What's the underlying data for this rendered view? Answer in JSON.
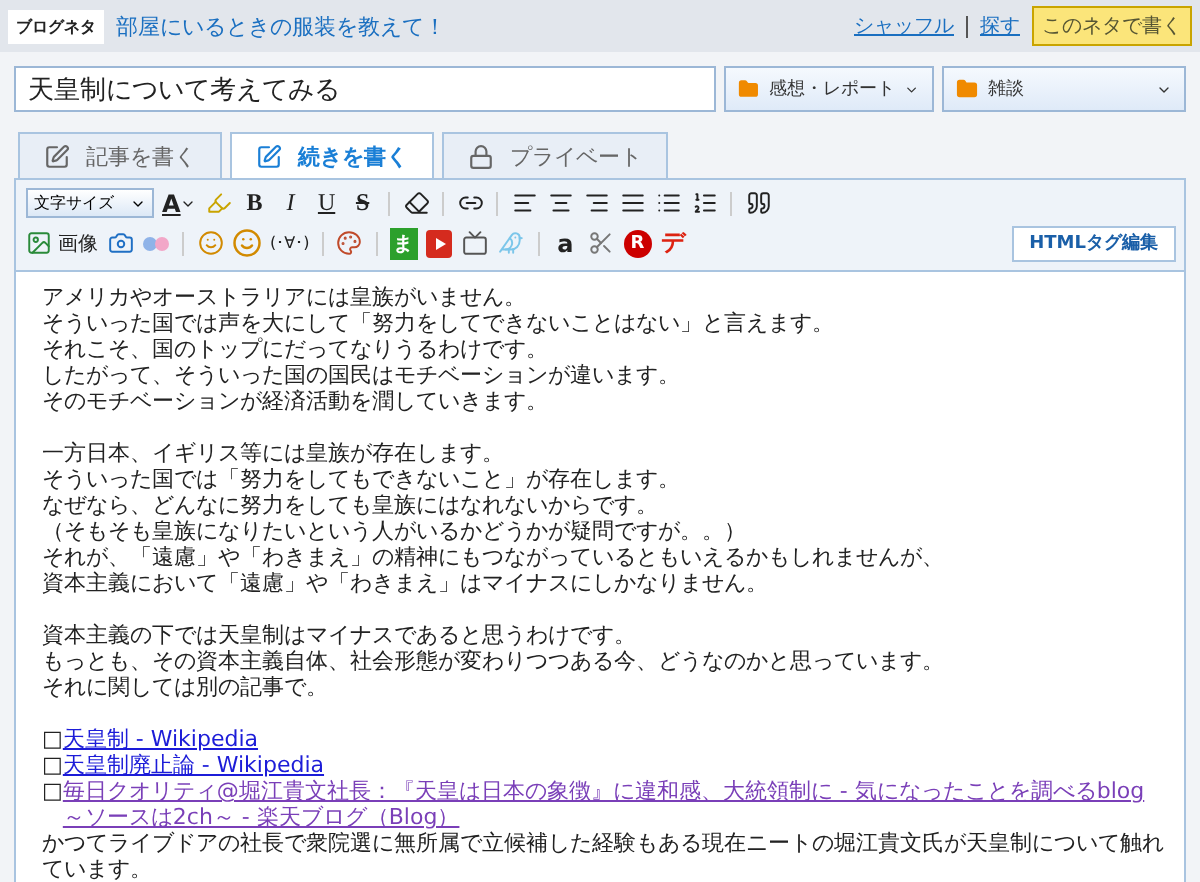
{
  "topbar": {
    "label": "ブログネタ",
    "topic": "部屋にいるときの服装を教えて！",
    "links": [
      "シャッフル",
      "探す"
    ],
    "button": "このネタで書く"
  },
  "title_field": {
    "value": "天皇制について考えてみる"
  },
  "categories": [
    {
      "label": "感想・レポート"
    },
    {
      "label": "雑談"
    }
  ],
  "tabs": [
    {
      "label": "記事を書く",
      "kind": "write",
      "selected": false
    },
    {
      "label": "続きを書く",
      "kind": "continue",
      "selected": true
    },
    {
      "label": "プライベート",
      "kind": "private",
      "selected": false
    }
  ],
  "toolbar": {
    "format_tools": [
      {
        "kind": "select",
        "text": "文字サイズ"
      },
      {
        "kind": "font-color",
        "text": "A"
      },
      {
        "kind": "highlight"
      },
      {
        "kind": "bold",
        "text": "B"
      },
      {
        "kind": "italic",
        "text": "I"
      },
      {
        "kind": "underline",
        "text": "U"
      },
      {
        "kind": "strike",
        "text": "S"
      },
      {
        "kind": "sep"
      },
      {
        "kind": "eraser"
      },
      {
        "kind": "sep"
      },
      {
        "kind": "link"
      },
      {
        "kind": "sep"
      },
      {
        "kind": "align-left"
      },
      {
        "kind": "align-center"
      },
      {
        "kind": "align-right"
      },
      {
        "kind": "align-justify"
      },
      {
        "kind": "list-bullet"
      },
      {
        "kind": "list-number"
      },
      {
        "kind": "sep"
      },
      {
        "kind": "quote"
      }
    ],
    "insert_tools": [
      {
        "kind": "image",
        "text": "画像"
      },
      {
        "kind": "photo"
      },
      {
        "kind": "dots"
      },
      {
        "kind": "sep"
      },
      {
        "kind": "smile"
      },
      {
        "kind": "smile-pen"
      },
      {
        "kind": "kaomoji",
        "text": "(･∀･)"
      },
      {
        "kind": "sep"
      },
      {
        "kind": "palette"
      },
      {
        "kind": "sep"
      },
      {
        "kind": "ma",
        "text": "ま"
      },
      {
        "kind": "video"
      },
      {
        "kind": "tv"
      },
      {
        "kind": "bird"
      },
      {
        "kind": "sep"
      },
      {
        "kind": "amazon",
        "text": "a"
      },
      {
        "kind": "scissors"
      },
      {
        "kind": "rakuten",
        "text": "R"
      },
      {
        "kind": "de",
        "text": "デ"
      }
    ],
    "html_button": "HTMLタグ編集"
  },
  "body": [
    {
      "kind": "paragraph",
      "lines": [
        "アメリカやオーストラリアには皇族がいません。",
        "そういった国では声を大にして「努力をしてできないことはない」と言えます。",
        "それこそ、国のトップにだってなりうるわけです。",
        "したがって、そういった国の国民はモチベーションが違います。",
        "そのモチベーションが経済活動を潤していきます。"
      ]
    },
    {
      "kind": "paragraph",
      "lines": [
        "一方日本、イギリス等には皇族が存在します。",
        "そういった国では「努力をしてもできないこと」が存在します。",
        "なぜなら、どんなに努力をしても皇族にはなれないからです。",
        "（そもそも皇族になりたいという人がいるかどうかが疑問ですが。。）",
        "それが、「遠慮」や「わきまえ」の精神にもつながっているともいえるかもしれませんが、",
        "資本主義において「遠慮」や「わきまえ」はマイナスにしかなりません。"
      ]
    },
    {
      "kind": "paragraph",
      "lines": [
        "資本主義の下では天皇制はマイナスであると思うわけです。",
        "もっとも、その資本主義自体、社会形態が変わりつつある今、どうなのかと思っています。",
        "それに関しては別の記事で。"
      ]
    },
    {
      "kind": "links",
      "items": [
        {
          "bullet": "□",
          "text": "天皇制 - Wikipedia",
          "visited": false
        },
        {
          "bullet": "□",
          "text": "天皇制廃止論 - Wikipedia",
          "visited": false
        },
        {
          "bullet": "□",
          "text": "毎日クオリティ@堀江貴文社長：『天皇は日本の象徴』に違和感、大統領制に - 気になったことを調べるblog ～ソースは2ch～ - 楽天ブログ（Blog）",
          "visited": true
        }
      ]
    },
    {
      "kind": "text",
      "text": "かつてライブドアの社長で衆院選に無所属で立候補した経験もある現在ニートの堀江貴文氏が天皇制について触れています。"
    }
  ]
}
